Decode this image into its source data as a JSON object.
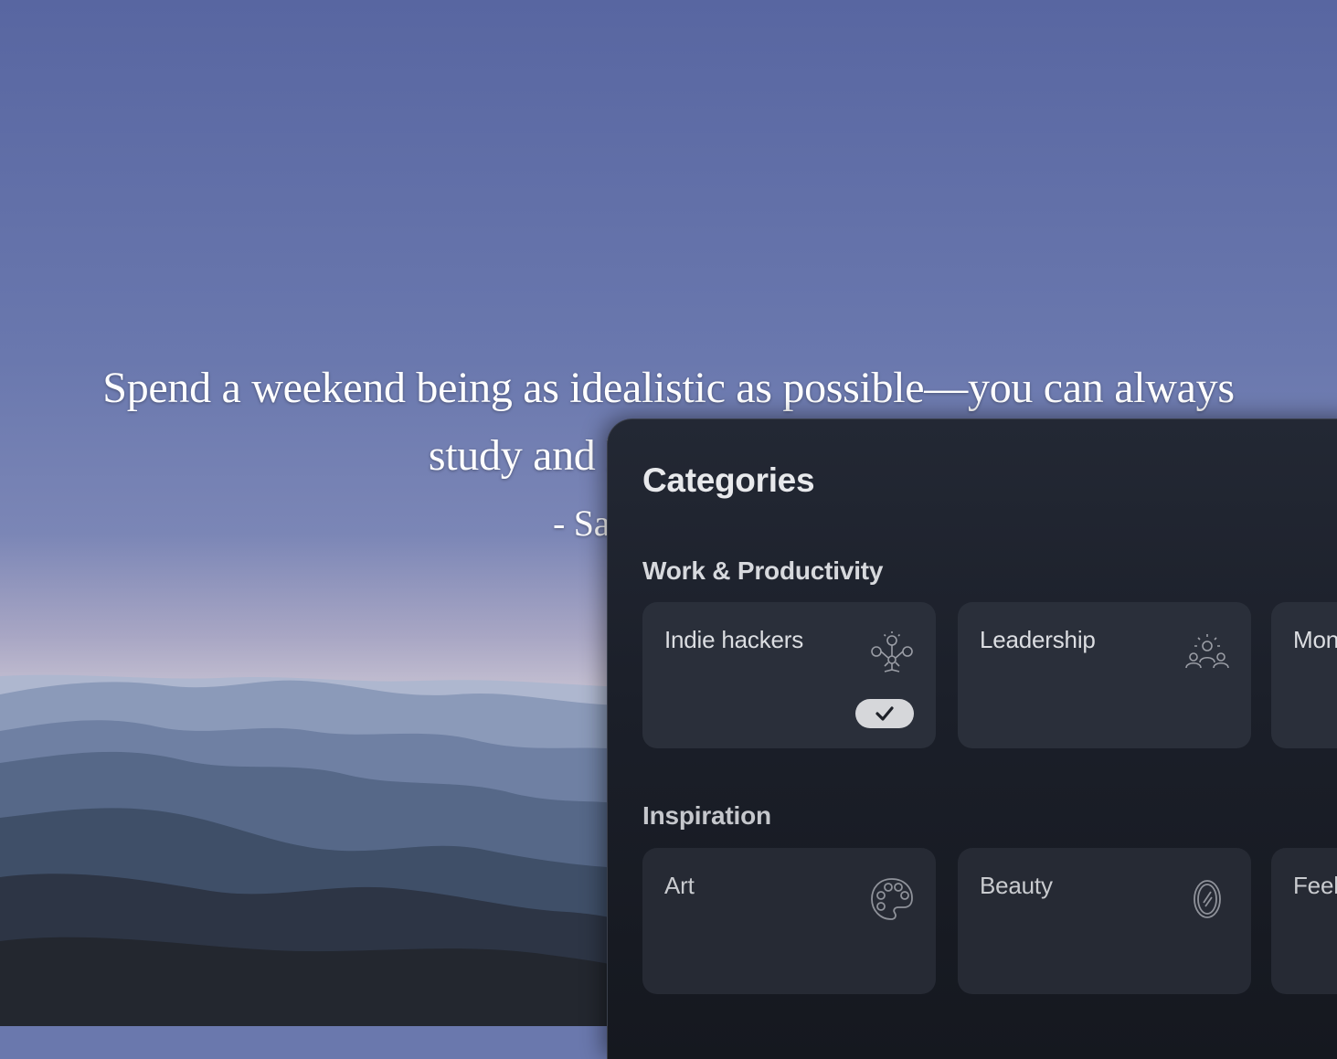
{
  "quote": {
    "line1": "Spend a weekend being as idealistic as possible—you can always",
    "line2": "study and learn later, but yo",
    "author": "- Sahil Lavingia"
  },
  "panel": {
    "title": "Categories",
    "sections": [
      {
        "title": "Work & Productivity",
        "cards": [
          {
            "label": "Indie hackers",
            "icon": "idea-network-icon",
            "selected": true
          },
          {
            "label": "Leadership",
            "icon": "team-leader-icon",
            "selected": false
          },
          {
            "label": "Mon",
            "icon": "",
            "selected": false
          }
        ]
      },
      {
        "title": "Inspiration",
        "cards": [
          {
            "label": "Art",
            "icon": "palette-icon",
            "selected": false
          },
          {
            "label": "Beauty",
            "icon": "mirror-icon",
            "selected": false
          },
          {
            "label": "Feel bless",
            "icon": "",
            "selected": false
          }
        ]
      }
    ]
  },
  "colors": {
    "sky_top": "#5a68a2",
    "panel_bg": "#1c2029",
    "card_bg": "#2a2f3a",
    "check_pill": "#d6d7da"
  }
}
